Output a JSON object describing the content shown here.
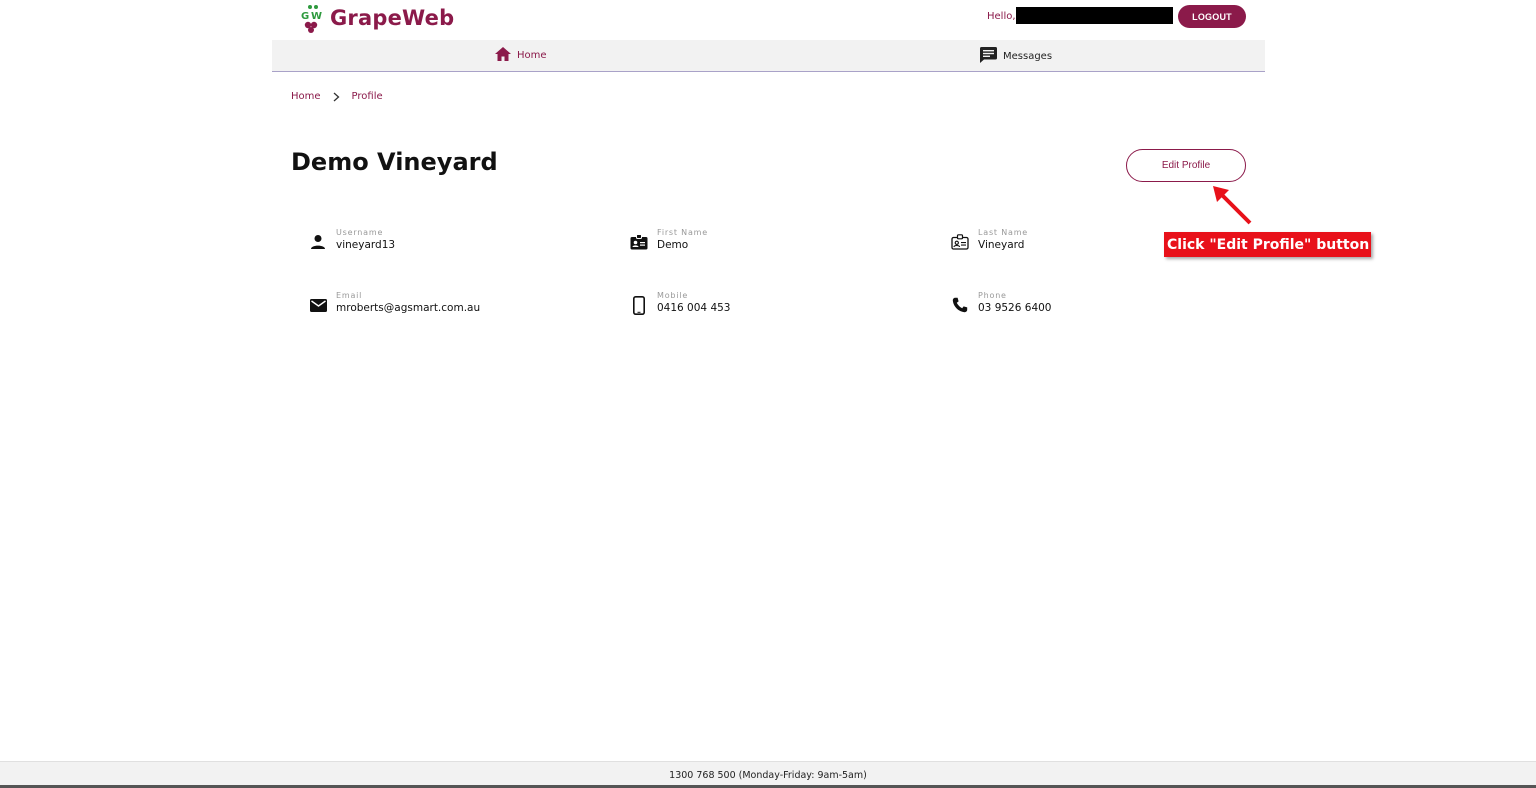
{
  "header": {
    "logo_prefix": "Grape",
    "logo_suffix": "Web",
    "logo_mark": "GW",
    "greeting": "Hello,",
    "logout_label": "LOGOUT"
  },
  "nav": {
    "home_label": "Home",
    "messages_label": "Messages"
  },
  "breadcrumb": {
    "items": [
      "Home",
      "Profile"
    ]
  },
  "page": {
    "title": "Demo Vineyard",
    "edit_button_label": "Edit Profile"
  },
  "annotation": {
    "text": "Click \"Edit Profile\" button"
  },
  "profile_fields": [
    {
      "label": "Username",
      "value": "vineyard13",
      "icon": "person-icon"
    },
    {
      "label": "First Name",
      "value": "Demo",
      "icon": "badge-icon"
    },
    {
      "label": "Last Name",
      "value": "Vineyard",
      "icon": "badge-outline-icon"
    },
    {
      "label": "Email",
      "value": "mroberts@agsmart.com.au",
      "icon": "mail-icon"
    },
    {
      "label": "Mobile",
      "value": "0416 004 453",
      "icon": "smartphone-icon"
    },
    {
      "label": "Phone",
      "value": "03 9526 6400",
      "icon": "phone-icon"
    }
  ],
  "footer": {
    "text": "1300 768 500 (Monday-Friday: 9am-5am)"
  },
  "colors": {
    "brand": "#8b1a4a",
    "brand_green": "#2e9a3e",
    "annotation_red": "#e8111a"
  }
}
